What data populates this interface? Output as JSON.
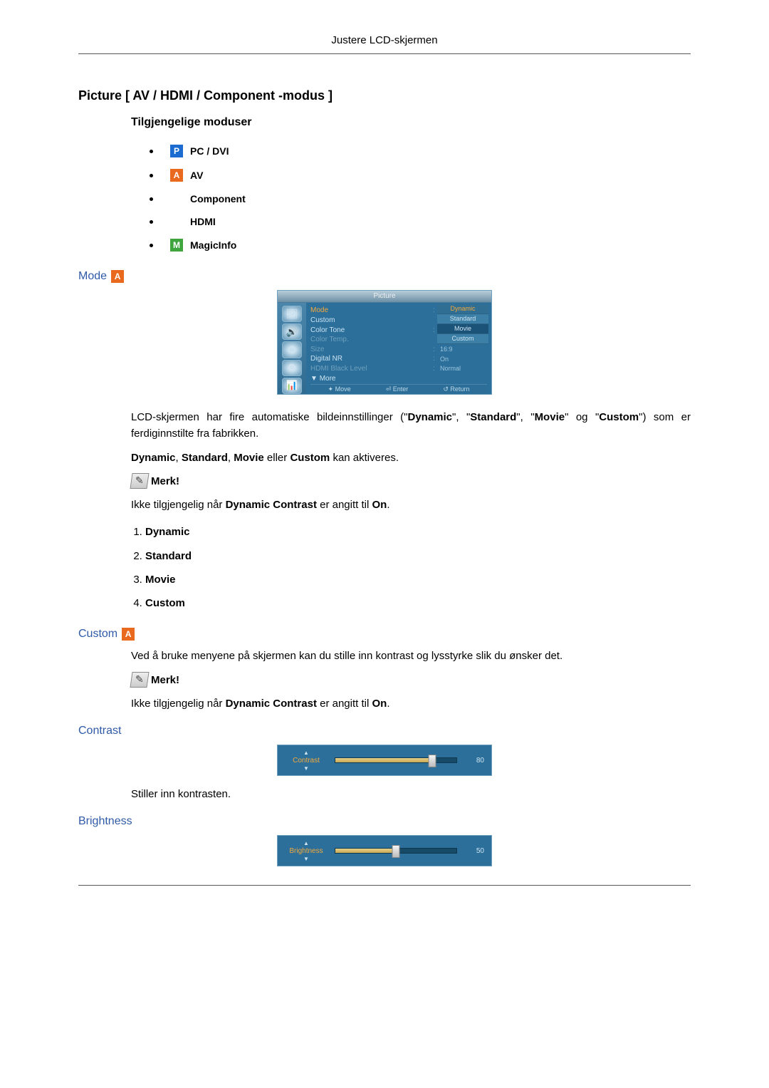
{
  "header": "Justere LCD-skjermen",
  "h1": "Picture [ AV / HDMI / Component -modus ]",
  "h2_modes": "Tilgjengelige moduser",
  "modes": {
    "pc_dvi": "PC / DVI",
    "av": "AV",
    "component": "Component",
    "hdmi": "HDMI",
    "magicinfo": "MagicInfo"
  },
  "h3_mode": "Mode",
  "osd": {
    "title": "Picture",
    "rows": {
      "mode": "Mode",
      "custom": "Custom",
      "color_tone": "Color Tone",
      "color_temp": "Color Temp.",
      "size": "Size",
      "digital_nr": "Digital NR",
      "hdmi_black": "HDMI Black Level"
    },
    "vals": {
      "size": "16:9",
      "digital_nr": "On",
      "hdmi_black": "Normal"
    },
    "dd": {
      "dynamic": "Dynamic",
      "standard": "Standard",
      "movie": "Movie",
      "custom": "Custom"
    },
    "more": "More",
    "footer": {
      "move": "Move",
      "enter": "Enter",
      "return": "Return"
    }
  },
  "desc_p1_a": "LCD-skjermen har fire automatiske bildeinnstillinger (\"",
  "desc_p1_b": "Dynamic",
  "desc_p1_c": "\", \"",
  "desc_p1_d": "Standard",
  "desc_p1_e": "\", \"",
  "desc_p1_f": "Movie",
  "desc_p1_g": "\" og \"",
  "desc_p1_h": "Custom",
  "desc_p1_i": "\") som er ferdiginnstilte fra fabrikken.",
  "desc_p2_a": "Dynamic",
  "desc_p2_b": ", ",
  "desc_p2_c": "Standard",
  "desc_p2_d": ", ",
  "desc_p2_e": "Movie",
  "desc_p2_f": " eller ",
  "desc_p2_g": "Custom",
  "desc_p2_h": " kan aktiveres.",
  "note_label": "Merk!",
  "note_dc_a": "Ikke tilgjengelig når ",
  "note_dc_b": "Dynamic Contrast",
  "note_dc_c": " er angitt til ",
  "note_dc_d": "On",
  "note_dc_e": ".",
  "ol": {
    "i1": "Dynamic",
    "i2": "Standard",
    "i3": "Movie",
    "i4": "Custom"
  },
  "h3_custom": "Custom",
  "custom_desc": "Ved å bruke menyene på skjermen kan du stille inn kontrast og lysstyrke slik du ønsker det.",
  "h3_contrast": "Contrast",
  "contrast": {
    "label": "Contrast",
    "value": "80",
    "percent": 80
  },
  "contrast_desc": "Stiller inn kontrasten.",
  "h3_brightness": "Brightness",
  "brightness": {
    "label": "Brightness",
    "value": "50",
    "percent": 50
  }
}
